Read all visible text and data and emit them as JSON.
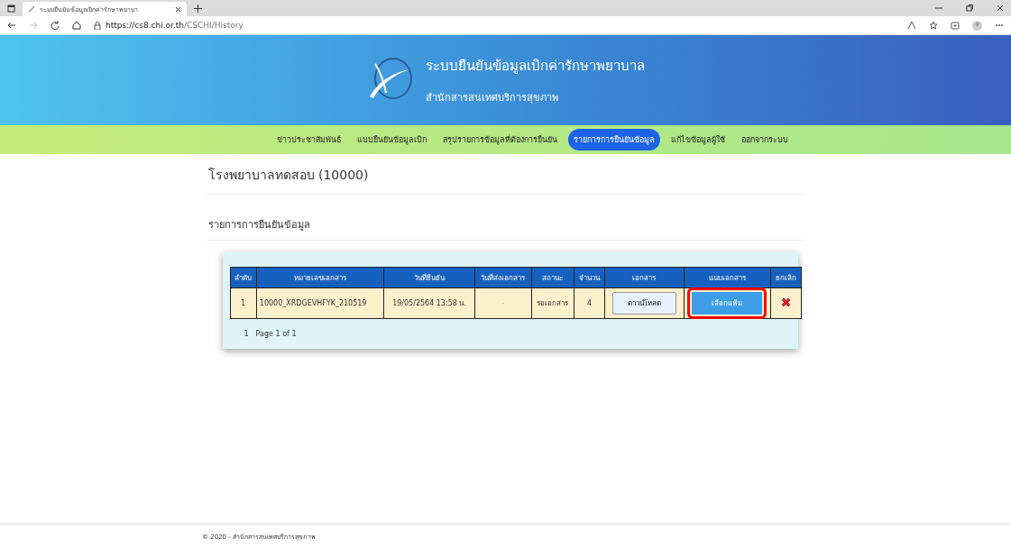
{
  "browser": {
    "tab_title": "ระบบยืนยันข้อมูลเบิกค่ารักษาพยาบา",
    "url_host": "https://cs8.chi.or.th",
    "url_path": "/CSCHI/History"
  },
  "header": {
    "title": "ระบบยืนยันข้อมูลเบิกค่ารักษาพยาบาล",
    "subtitle": "สำนักสารสนเทศบริการสุขภาพ"
  },
  "nav": [
    {
      "label": "ข่าวประชาสัมพันธ์",
      "selected": false
    },
    {
      "label": "แบบยืนยันข้อมูลเบิก",
      "selected": false
    },
    {
      "label": "สรุปรายการข้อมูลที่ต้องการยืนยัน",
      "selected": false
    },
    {
      "label": "รายการการยืนยันข้อมูล",
      "selected": true
    },
    {
      "label": "แก้ไขข้อมูลผู้ใช้",
      "selected": false
    },
    {
      "label": "ออกจากระบบ",
      "selected": false
    }
  ],
  "hospital": "โรงพยาบาลทดสอบ (10000)",
  "section_title": "รายการการยืนยันข้อมูล",
  "table": {
    "columns": [
      "ลำดับ",
      "หมายเลขเอกสาร",
      "วันที่ยืนยัน",
      "วันที่ส่งเอกสาร",
      "สถานะ",
      "จำนวน",
      "เอกสาร",
      "แนบเอกสาร",
      "ยกเลิก"
    ],
    "rows": [
      {
        "no": "1",
        "doc_no": "10000_XRDGEVHFYK_210519",
        "confirm_date": "19/05/2564 13:58 น.",
        "send_date": "-",
        "status": "รอเอกสาร",
        "count": "4",
        "download": "ดาวน์โหลด",
        "attach": "เลือกแฟ้ม",
        "attach_highlighted": true
      }
    ]
  },
  "pager": {
    "page": "1",
    "text": "Page 1 of 1"
  },
  "footer": "© 2020 - สำนักสารสนเทศบริการสุขภาพ"
}
